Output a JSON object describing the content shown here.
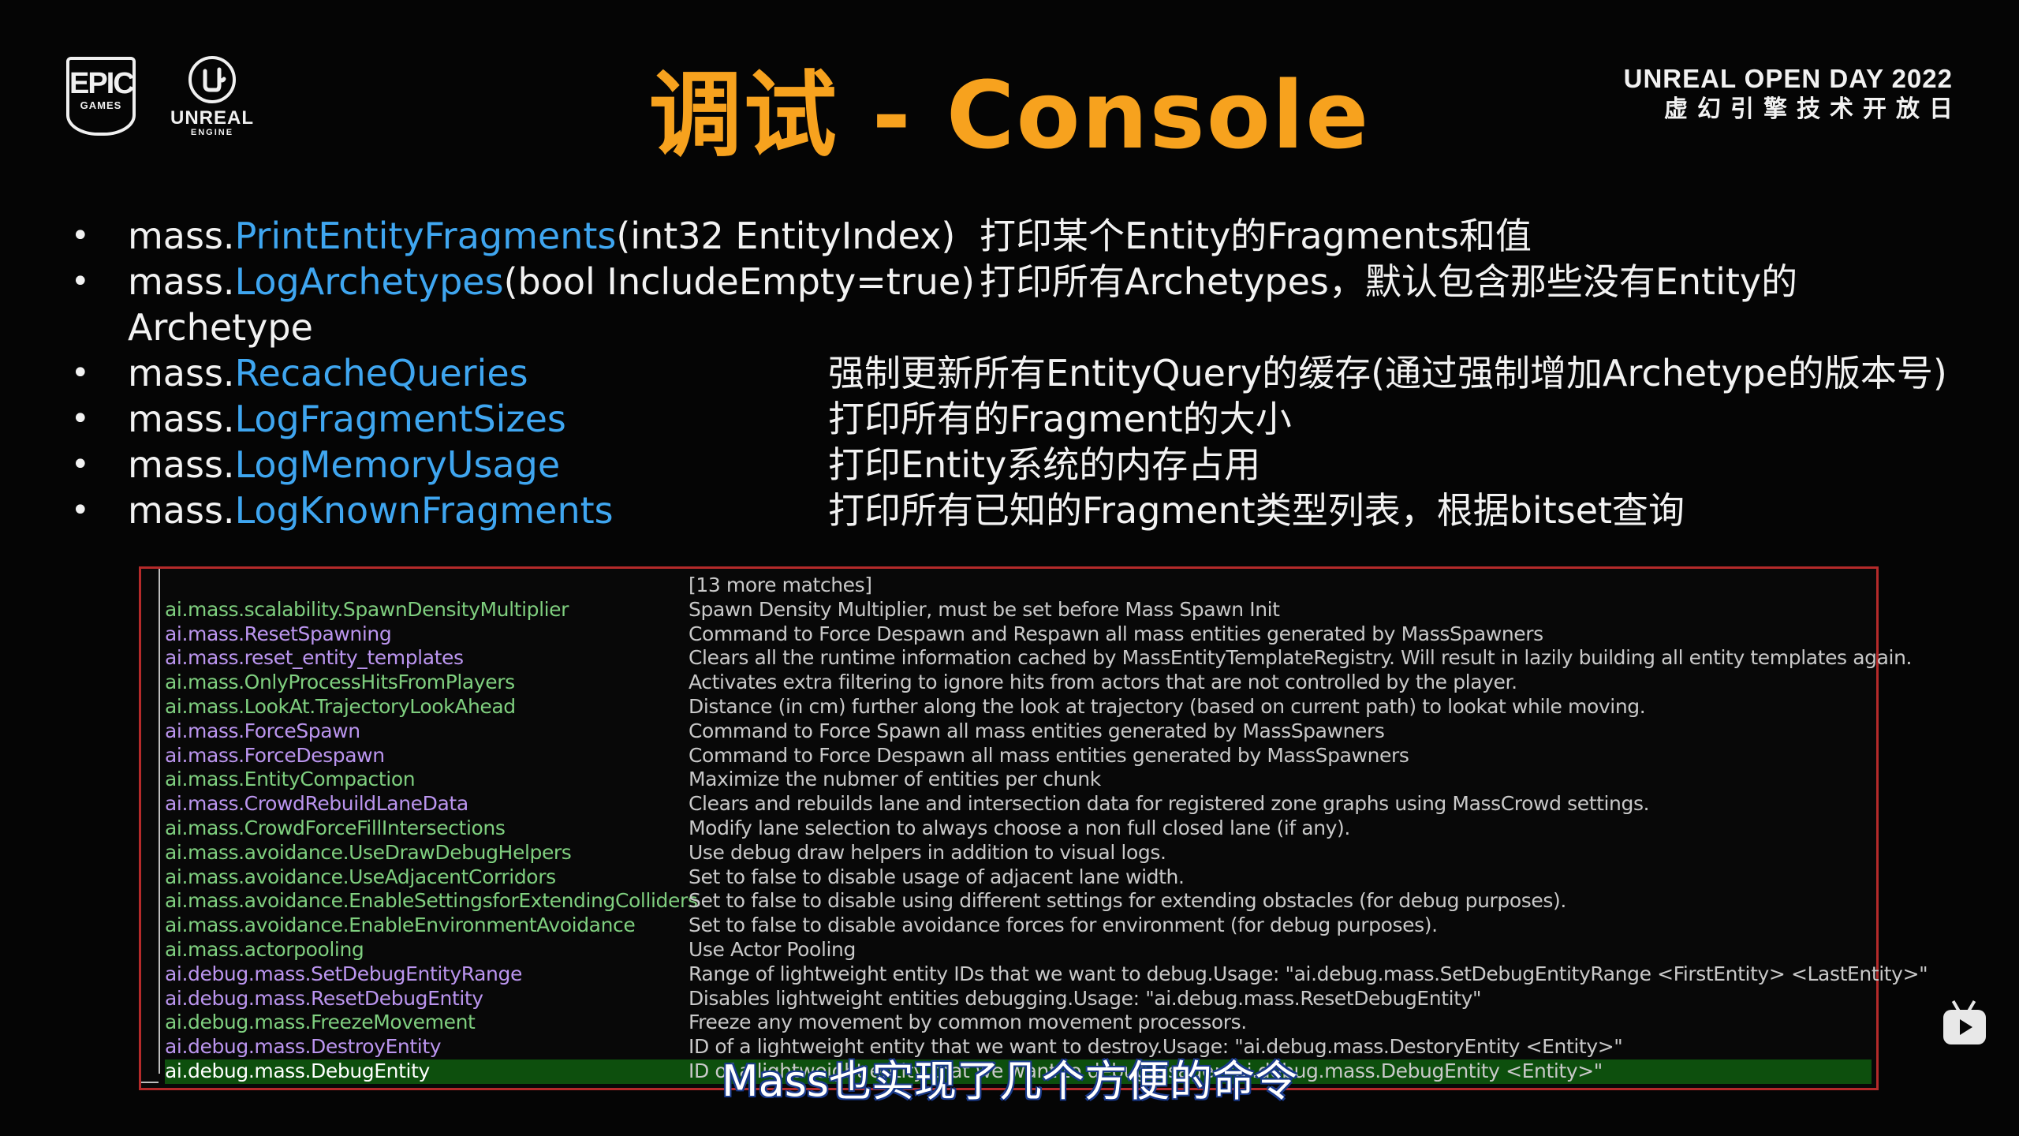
{
  "header": {
    "title": "调试 - Console",
    "epic_logo": {
      "line1": "EPIC",
      "line2": "GAMES"
    },
    "ue_logo": {
      "line1": "UNREAL",
      "line2": "ENGINE"
    },
    "event_line1": "UNREAL OPEN DAY 2022",
    "event_line2": "虚幻引擎技术开放日"
  },
  "bullets": [
    {
      "prefix": "mass.",
      "highlight": "PrintEntityFragments",
      "suffix": "(int32 EntityIndex)",
      "desc": "打印某个Entity的Fragments和值"
    },
    {
      "prefix": "mass.",
      "highlight": "LogArchetypes",
      "suffix": "(bool IncludeEmpty=true)",
      "desc": "打印所有Archetypes，默认包含那些没有Entity的",
      "continuation": "Archetype"
    },
    {
      "prefix": "mass.",
      "highlight": "RecacheQueries",
      "suffix": "",
      "desc": "强制更新所有EntityQuery的缓存(通过强制增加Archetype的版本号)"
    },
    {
      "prefix": "mass.",
      "highlight": "LogFragmentSizes",
      "suffix": "",
      "desc": "打印所有的Fragment的大小"
    },
    {
      "prefix": "mass.",
      "highlight": "LogMemoryUsage",
      "suffix": "",
      "desc": "打印Entity系统的内存占用"
    },
    {
      "prefix": "mass.",
      "highlight": "LogKnownFragments",
      "suffix": "",
      "desc": "打印所有已知的Fragment类型列表，根据bitset查询"
    }
  ],
  "console": {
    "more_matches": "[13 more matches]",
    "rows": [
      {
        "name": "ai.mass.scalability.SpawnDensityMultiplier",
        "desc": "Spawn Density Multiplier, must be set before Mass Spawn Init",
        "kind": "green"
      },
      {
        "name": "ai.mass.ResetSpawning",
        "desc": "Command to Force Despawn and Respawn all mass entities generated by MassSpawners",
        "kind": "purple"
      },
      {
        "name": "ai.mass.reset_entity_templates",
        "desc": "Clears all the runtime information cached by MassEntityTemplateRegistry. Will result in lazily building all entity templates again.",
        "kind": "purple"
      },
      {
        "name": "ai.mass.OnlyProcessHitsFromPlayers",
        "desc": "Activates extra filtering to ignore hits from actors that are not controlled by the player.",
        "kind": "green"
      },
      {
        "name": "ai.mass.LookAt.TrajectoryLookAhead",
        "desc": "Distance (in cm) further along the look at trajectory (based on current path) to lookat while moving.",
        "kind": "green"
      },
      {
        "name": "ai.mass.ForceSpawn",
        "desc": "Command to Force Spawn all mass entities generated by MassSpawners",
        "kind": "purple"
      },
      {
        "name": "ai.mass.ForceDespawn",
        "desc": "Command to Force Despawn all mass entities generated by MassSpawners",
        "kind": "purple"
      },
      {
        "name": "ai.mass.EntityCompaction",
        "desc": "Maximize the nubmer of entities per chunk",
        "kind": "green"
      },
      {
        "name": "ai.mass.CrowdRebuildLaneData",
        "desc": "Clears and rebuilds lane and intersection data for registered zone graphs using MassCrowd settings.",
        "kind": "purple"
      },
      {
        "name": "ai.mass.CrowdForceFillIntersections",
        "desc": "Modify lane selection to always choose a non full closed lane (if any).",
        "kind": "green"
      },
      {
        "name": "ai.mass.avoidance.UseDrawDebugHelpers",
        "desc": "Use debug draw helpers in addition to visual logs.",
        "kind": "green"
      },
      {
        "name": "ai.mass.avoidance.UseAdjacentCorridors",
        "desc": "Set to false to disable usage of adjacent lane width.",
        "kind": "green"
      },
      {
        "name": "ai.mass.avoidance.EnableSettingsforExtendingColliders",
        "desc": "Set to false to disable using different settings for extending obstacles (for debug purposes).",
        "kind": "green"
      },
      {
        "name": "ai.mass.avoidance.EnableEnvironmentAvoidance",
        "desc": "Set to false to disable avoidance forces for environment (for debug purposes).",
        "kind": "green"
      },
      {
        "name": "ai.mass.actorpooling",
        "desc": "Use Actor Pooling",
        "kind": "green"
      },
      {
        "name": "ai.debug.mass.SetDebugEntityRange",
        "desc": "Range of lightweight entity IDs that we want to debug.Usage: \"ai.debug.mass.SetDebugEntityRange <FirstEntity> <LastEntity>\"",
        "kind": "purple"
      },
      {
        "name": "ai.debug.mass.ResetDebugEntity",
        "desc": "Disables lightweight entities debugging.Usage: \"ai.debug.mass.ResetDebugEntity\"",
        "kind": "purple"
      },
      {
        "name": "ai.debug.mass.FreezeMovement",
        "desc": "Freeze any movement by common movement processors.",
        "kind": "green"
      },
      {
        "name": "ai.debug.mass.DestroyEntity",
        "desc": "ID of a lightweight entity that we want to destroy.Usage: \"ai.debug.mass.DestoryEntity <Entity>\"",
        "kind": "purple"
      },
      {
        "name": "ai.debug.mass.DebugEntity",
        "desc": "ID of a lightweight entity that we want to debug.Usage: \"ai.debug.mass.DebugEntity <Entity>\"",
        "kind": "selected"
      }
    ]
  },
  "subtitle": "Mass也实现了几个方便的命令",
  "colors": {
    "title": "#f7a21e",
    "command_highlight": "#3fa6f0",
    "console_border": "#b52a2a",
    "console_green": "#7fcf7f",
    "console_purple": "#bb95ef",
    "selected_row": "#0d4f0d"
  }
}
